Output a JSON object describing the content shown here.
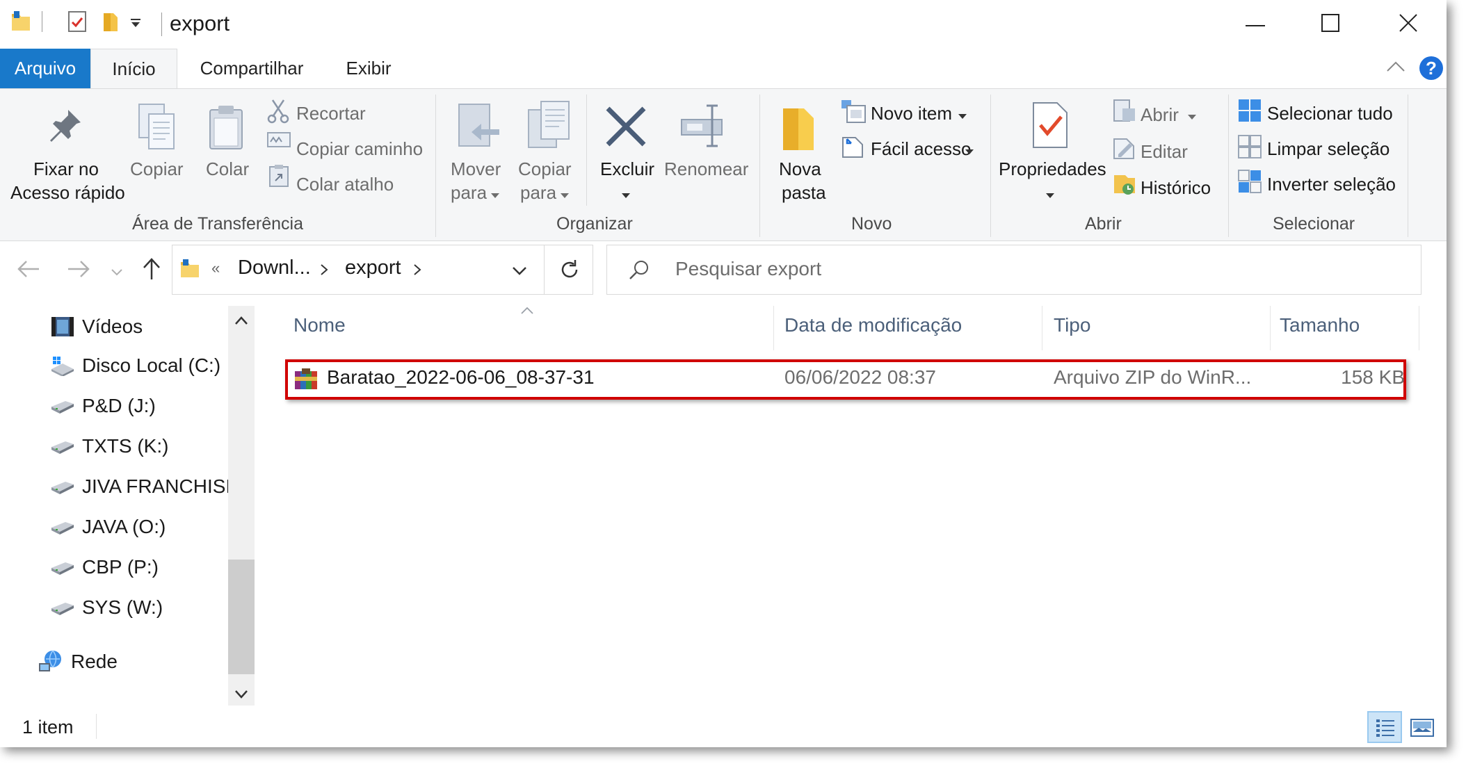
{
  "window": {
    "title": "export",
    "controls": {
      "minimize": "—",
      "maximize": "☐",
      "close": "✕"
    }
  },
  "ribbon_tabs": [
    "Arquivo",
    "Início",
    "Compartilhar",
    "Exibir"
  ],
  "ribbon": {
    "clipboard": {
      "pin_label_1": "Fixar no",
      "pin_label_2": "Acesso rápido",
      "copy": "Copiar",
      "paste": "Colar",
      "cut": "Recortar",
      "copy_path": "Copiar caminho",
      "paste_shortcut": "Colar atalho",
      "group": "Área de Transferência"
    },
    "organize": {
      "move_1": "Mover",
      "move_2": "para",
      "copy_1": "Copiar",
      "copy_2": "para",
      "delete": "Excluir",
      "rename": "Renomear",
      "group": "Organizar"
    },
    "new": {
      "folder_1": "Nova",
      "folder_2": "pasta",
      "new_item": "Novo item",
      "easy_access": "Fácil acesso",
      "group": "Novo"
    },
    "open": {
      "properties": "Propriedades",
      "open": "Abrir",
      "edit": "Editar",
      "history": "Histórico",
      "group": "Abrir"
    },
    "select": {
      "select_all": "Selecionar tudo",
      "select_none": "Limpar seleção",
      "invert": "Inverter seleção",
      "group": "Selecionar"
    }
  },
  "address": {
    "overflow": "«",
    "crumb_1": "Downl...",
    "crumb_2": "export",
    "search_placeholder": "Pesquisar export"
  },
  "nav_pane": {
    "items": [
      "Vídeos",
      "Disco Local (C:)",
      "P&D (J:)",
      "TXTS (K:)",
      "JIVA FRANCHISII",
      "JAVA (O:)",
      "CBP (P:)",
      "SYS (W:)",
      "Rede"
    ]
  },
  "file_list": {
    "columns": [
      "Nome",
      "Data de modificação",
      "Tipo",
      "Tamanho"
    ],
    "rows": [
      {
        "name": "Baratao_2022-06-06_08-37-31",
        "modified": "06/06/2022 08:37",
        "type": "Arquivo ZIP do WinR...",
        "size": "158 KB"
      }
    ]
  },
  "status_bar": {
    "count": "1 item"
  },
  "colors": {
    "accent": "#1979ca",
    "highlight": "#d00000"
  }
}
